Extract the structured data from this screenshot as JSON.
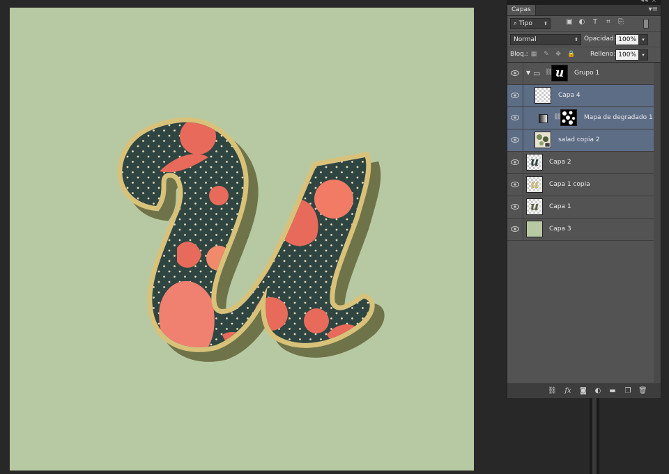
{
  "panel": {
    "tab_label": "Capas",
    "menu_icon": "panel-menu-icon",
    "filter": {
      "value": "Tipo",
      "icon": "search-icon"
    },
    "blend_mode": {
      "value": "Normal"
    },
    "opacity": {
      "label": "Opacidad:",
      "value": "100%"
    },
    "lock": {
      "label": "Bloq.:"
    },
    "fill": {
      "label": "Relleno:",
      "value": "100%"
    },
    "filter_icons": [
      "image-filter-icon",
      "adjustment-filter-icon",
      "type-filter-icon",
      "shape-filter-icon",
      "smart-object-filter-icon"
    ],
    "lock_icons": [
      "lock-transparency-icon",
      "lock-pixels-icon",
      "lock-position-icon",
      "lock-all-icon"
    ],
    "footer_icons": [
      "link-layers-icon",
      "fx-icon",
      "mask-icon",
      "adjustment-layer-icon",
      "new-group-icon",
      "new-layer-icon",
      "trash-icon"
    ]
  },
  "layers": [
    {
      "name": "Grupo 1",
      "type": "group",
      "selected": false,
      "thumb": "u-black"
    },
    {
      "name": "Capa 4",
      "type": "layer",
      "selected": true,
      "thumb": "transparent"
    },
    {
      "name": "Mapa de degradado 1",
      "type": "adjustment",
      "selected": true,
      "thumb": "mask"
    },
    {
      "name": "salad copia 2",
      "type": "smart",
      "selected": true,
      "thumb": "salad"
    },
    {
      "name": "Capa 2",
      "type": "layer",
      "selected": false,
      "thumb": "u-dark"
    },
    {
      "name": "Capa 1 copia",
      "type": "layer",
      "selected": false,
      "thumb": "u-gold"
    },
    {
      "name": "Capa 1",
      "type": "layer",
      "selected": false,
      "thumb": "u-olive"
    },
    {
      "name": "Capa 3",
      "type": "layer",
      "selected": false,
      "thumb": "solid"
    }
  ],
  "colors": {
    "canvas_bg": "#b7c9a2",
    "letter_fill": "#2f4542",
    "letter_outline": "#d8c27a",
    "letter_shadow": "#6f7349",
    "pattern_red": "#e86a5a",
    "selected_row": "#5d6d86"
  }
}
